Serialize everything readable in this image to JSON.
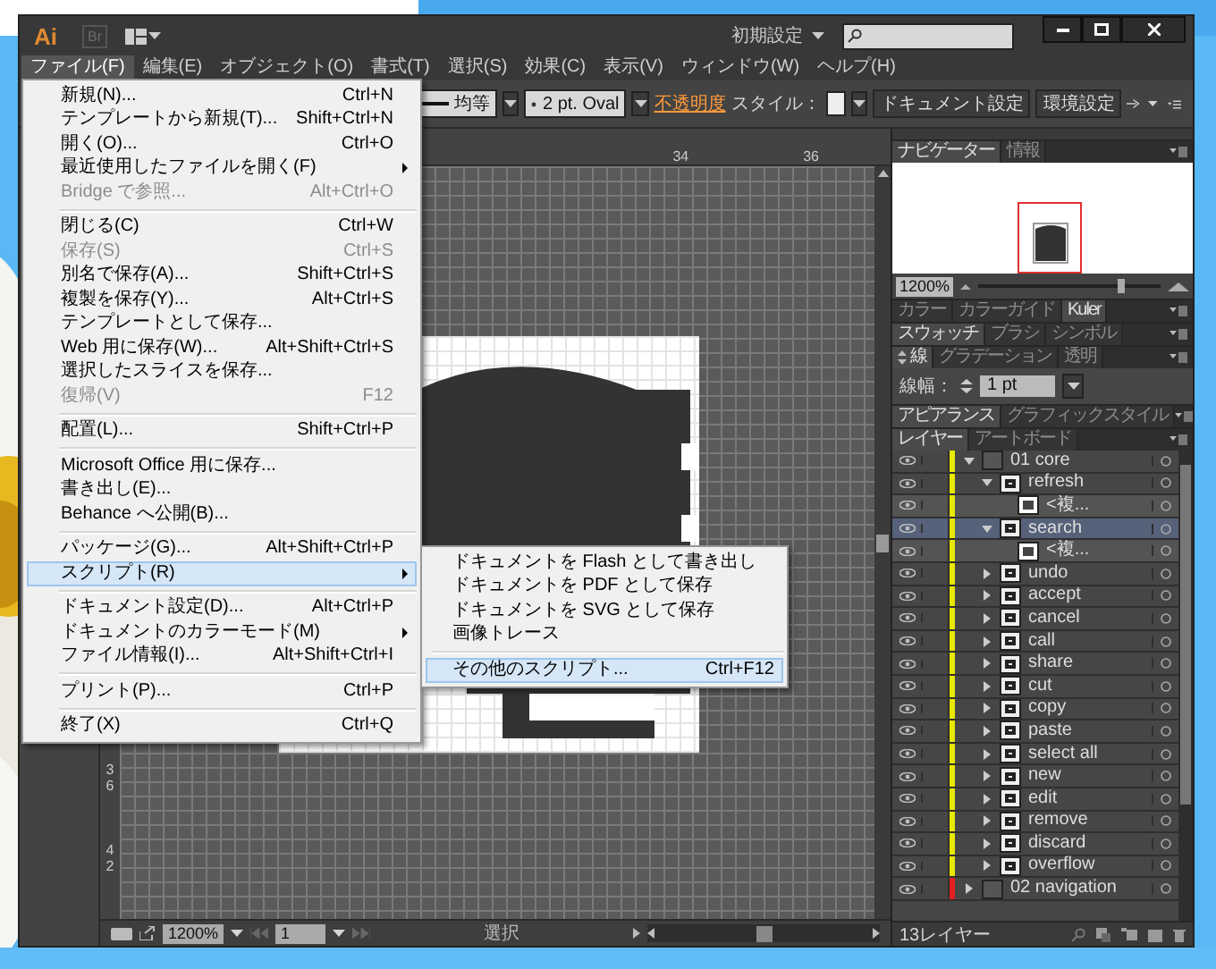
{
  "title_bar": {
    "logo": "Ai",
    "bridge": "Br",
    "workspace": "初期設定"
  },
  "menu_bar": [
    {
      "label": "ファイル(F)",
      "selected": true
    },
    {
      "label": "編集(E)",
      "selected": false
    },
    {
      "label": "オブジェクト(O)",
      "selected": false
    },
    {
      "label": "書式(T)",
      "selected": false
    },
    {
      "label": "選択(S)",
      "selected": false
    },
    {
      "label": "効果(C)",
      "selected": false
    },
    {
      "label": "表示(V)",
      "selected": false
    },
    {
      "label": "ウィンドウ(W)",
      "selected": false
    },
    {
      "label": "ヘルプ(H)",
      "selected": false
    }
  ],
  "control_bar": {
    "profile": "均等",
    "brush": "2 pt. Oval",
    "opacity_link": "不透明度",
    "style_label": "スタイル：",
    "buttons": [
      "ドキュメント設定",
      "環境設定"
    ]
  },
  "file_menu": [
    {
      "kind": "item",
      "label": "新規(N)...",
      "shortcut": "Ctrl+N",
      "disabled": false,
      "submenu": false,
      "selected": false
    },
    {
      "kind": "item",
      "label": "テンプレートから新規(T)...",
      "shortcut": "Shift+Ctrl+N",
      "disabled": false,
      "submenu": false,
      "selected": false
    },
    {
      "kind": "item",
      "label": "開く(O)...",
      "shortcut": "Ctrl+O",
      "disabled": false,
      "submenu": false,
      "selected": false
    },
    {
      "kind": "item",
      "label": "最近使用したファイルを開く(F)",
      "disabled": false,
      "submenu": true,
      "selected": false
    },
    {
      "kind": "item",
      "label": "Bridge で参照...",
      "shortcut": "Alt+Ctrl+O",
      "disabled": true,
      "submenu": false,
      "selected": false
    },
    {
      "kind": "separator"
    },
    {
      "kind": "item",
      "label": "閉じる(C)",
      "shortcut": "Ctrl+W",
      "disabled": false,
      "submenu": false,
      "selected": false
    },
    {
      "kind": "item",
      "label": "保存(S)",
      "shortcut": "Ctrl+S",
      "disabled": true,
      "submenu": false,
      "selected": false
    },
    {
      "kind": "item",
      "label": "別名で保存(A)...",
      "shortcut": "Shift+Ctrl+S",
      "disabled": false,
      "submenu": false,
      "selected": false
    },
    {
      "kind": "item",
      "label": "複製を保存(Y)...",
      "shortcut": "Alt+Ctrl+S",
      "disabled": false,
      "submenu": false,
      "selected": false
    },
    {
      "kind": "item",
      "label": "テンプレートとして保存...",
      "disabled": false,
      "submenu": false,
      "selected": false
    },
    {
      "kind": "item",
      "label": "Web 用に保存(W)...",
      "shortcut": "Alt+Shift+Ctrl+S",
      "disabled": false,
      "submenu": false,
      "selected": false
    },
    {
      "kind": "item",
      "label": "選択したスライスを保存...",
      "disabled": false,
      "submenu": false,
      "selected": false
    },
    {
      "kind": "item",
      "label": "復帰(V)",
      "shortcut": "F12",
      "disabled": true,
      "submenu": false,
      "selected": false
    },
    {
      "kind": "separator"
    },
    {
      "kind": "item",
      "label": "配置(L)...",
      "shortcut": "Shift+Ctrl+P",
      "disabled": false,
      "submenu": false,
      "selected": false
    },
    {
      "kind": "separator"
    },
    {
      "kind": "item",
      "label": "Microsoft Office 用に保存...",
      "disabled": false,
      "submenu": false,
      "selected": false
    },
    {
      "kind": "item",
      "label": "書き出し(E)...",
      "disabled": false,
      "submenu": false,
      "selected": false
    },
    {
      "kind": "item",
      "label": "Behance へ公開(B)...",
      "disabled": false,
      "submenu": false,
      "selected": false
    },
    {
      "kind": "separator"
    },
    {
      "kind": "item",
      "label": "パッケージ(G)...",
      "shortcut": "Alt+Shift+Ctrl+P",
      "disabled": false,
      "submenu": false,
      "selected": false
    },
    {
      "kind": "item",
      "label": "スクリプト(R)",
      "disabled": false,
      "submenu": true,
      "selected": true
    },
    {
      "kind": "separator"
    },
    {
      "kind": "item",
      "label": "ドキュメント設定(D)...",
      "shortcut": "Alt+Ctrl+P",
      "disabled": false,
      "submenu": false,
      "selected": false
    },
    {
      "kind": "item",
      "label": "ドキュメントのカラーモード(M)",
      "disabled": false,
      "submenu": true,
      "selected": false
    },
    {
      "kind": "item",
      "label": "ファイル情報(I)...",
      "shortcut": "Alt+Shift+Ctrl+I",
      "disabled": false,
      "submenu": false,
      "selected": false
    },
    {
      "kind": "separator"
    },
    {
      "kind": "item",
      "label": "プリント(P)...",
      "shortcut": "Ctrl+P",
      "disabled": false,
      "submenu": false,
      "selected": false
    },
    {
      "kind": "separator"
    },
    {
      "kind": "item",
      "label": "終了(X)",
      "shortcut": "Ctrl+Q",
      "disabled": false,
      "submenu": false,
      "selected": false
    }
  ],
  "script_submenu": [
    {
      "kind": "item",
      "label": "ドキュメントを Flash として書き出し",
      "selected": false
    },
    {
      "kind": "item",
      "label": "ドキュメントを PDF として保存",
      "selected": false
    },
    {
      "kind": "item",
      "label": "ドキュメントを SVG として保存",
      "selected": false
    },
    {
      "kind": "item",
      "label": "画像トレース",
      "selected": false
    },
    {
      "kind": "separator"
    },
    {
      "kind": "item",
      "label": "その他のスクリプト...",
      "shortcut": "Ctrl+F12",
      "selected": true
    }
  ],
  "canvas": {
    "top_ruler": [
      "34",
      "36"
    ],
    "left_ruler": [
      "36",
      "42"
    ]
  },
  "status_bar": {
    "zoom": "1200%",
    "artboard": "1",
    "tool": "選択"
  },
  "panels": [
    {
      "kind": "navigator",
      "tabs": [
        {
          "label": "ナビゲーター",
          "selected": true
        },
        {
          "label": "情報",
          "selected": false
        }
      ],
      "zoom": "1200%",
      "level": 0.78
    },
    {
      "kind": "collapsed",
      "tabs": [
        {
          "label": "カラー",
          "selected": false
        },
        {
          "label": "カラーガイド",
          "selected": false
        },
        {
          "label": "Kuler",
          "selected": true
        }
      ]
    },
    {
      "kind": "collapsed",
      "tabs": [
        {
          "label": "スウォッチ",
          "selected": true
        },
        {
          "label": "ブラシ",
          "selected": false
        },
        {
          "label": "シンボル",
          "selected": false
        }
      ]
    },
    {
      "kind": "stroke",
      "tabs": [
        {
          "label": "線",
          "selected": true
        },
        {
          "label": "グラデーション",
          "selected": false
        },
        {
          "label": "透明",
          "selected": false
        }
      ],
      "weight_label": "線幅：",
      "weight": "1 pt"
    },
    {
      "kind": "collapsed",
      "tabs": [
        {
          "label": "アピアランス",
          "selected": true
        },
        {
          "label": "グラフィックスタイル",
          "selected": false
        }
      ]
    },
    {
      "kind": "layers",
      "tabs": [
        {
          "label": "レイヤー",
          "selected": true
        },
        {
          "label": "アートボード",
          "selected": false
        }
      ]
    }
  ],
  "layers": {
    "count": "13レイヤー",
    "items": [
      {
        "kind": "layer",
        "name": "01 core",
        "color": "#e8e800",
        "expanded": true,
        "selected": false,
        "children": [
          {
            "kind": "group",
            "name": "refresh",
            "expanded": true,
            "selected": false,
            "children": [
              {
                "kind": "path",
                "name": "<複...",
                "selected": false
              }
            ]
          },
          {
            "kind": "group",
            "name": "search",
            "expanded": true,
            "selected": true,
            "children": [
              {
                "kind": "path",
                "name": "<複...",
                "selected": false
              }
            ]
          },
          {
            "kind": "group",
            "name": "undo",
            "expanded": false,
            "selected": false
          },
          {
            "kind": "group",
            "name": "accept",
            "expanded": false,
            "selected": false
          },
          {
            "kind": "group",
            "name": "cancel",
            "expanded": false,
            "selected": false
          },
          {
            "kind": "group",
            "name": "call",
            "expanded": false,
            "selected": false
          },
          {
            "kind": "group",
            "name": "share",
            "expanded": false,
            "selected": false
          },
          {
            "kind": "group",
            "name": "cut",
            "expanded": false,
            "selected": false
          },
          {
            "kind": "group",
            "name": "copy",
            "expanded": false,
            "selected": false
          },
          {
            "kind": "group",
            "name": "paste",
            "expanded": false,
            "selected": false
          },
          {
            "kind": "group",
            "name": "select all",
            "expanded": false,
            "selected": false
          },
          {
            "kind": "group",
            "name": "new",
            "expanded": false,
            "selected": false
          },
          {
            "kind": "group",
            "name": "edit",
            "expanded": false,
            "selected": false
          },
          {
            "kind": "group",
            "name": "remove",
            "expanded": false,
            "selected": false
          },
          {
            "kind": "group",
            "name": "discard",
            "expanded": false,
            "selected": false
          },
          {
            "kind": "group",
            "name": "overflow",
            "expanded": false,
            "selected": false
          }
        ]
      },
      {
        "kind": "layer",
        "name": "02 navigation",
        "color": "#e02020",
        "expanded": false,
        "selected": false
      }
    ]
  }
}
